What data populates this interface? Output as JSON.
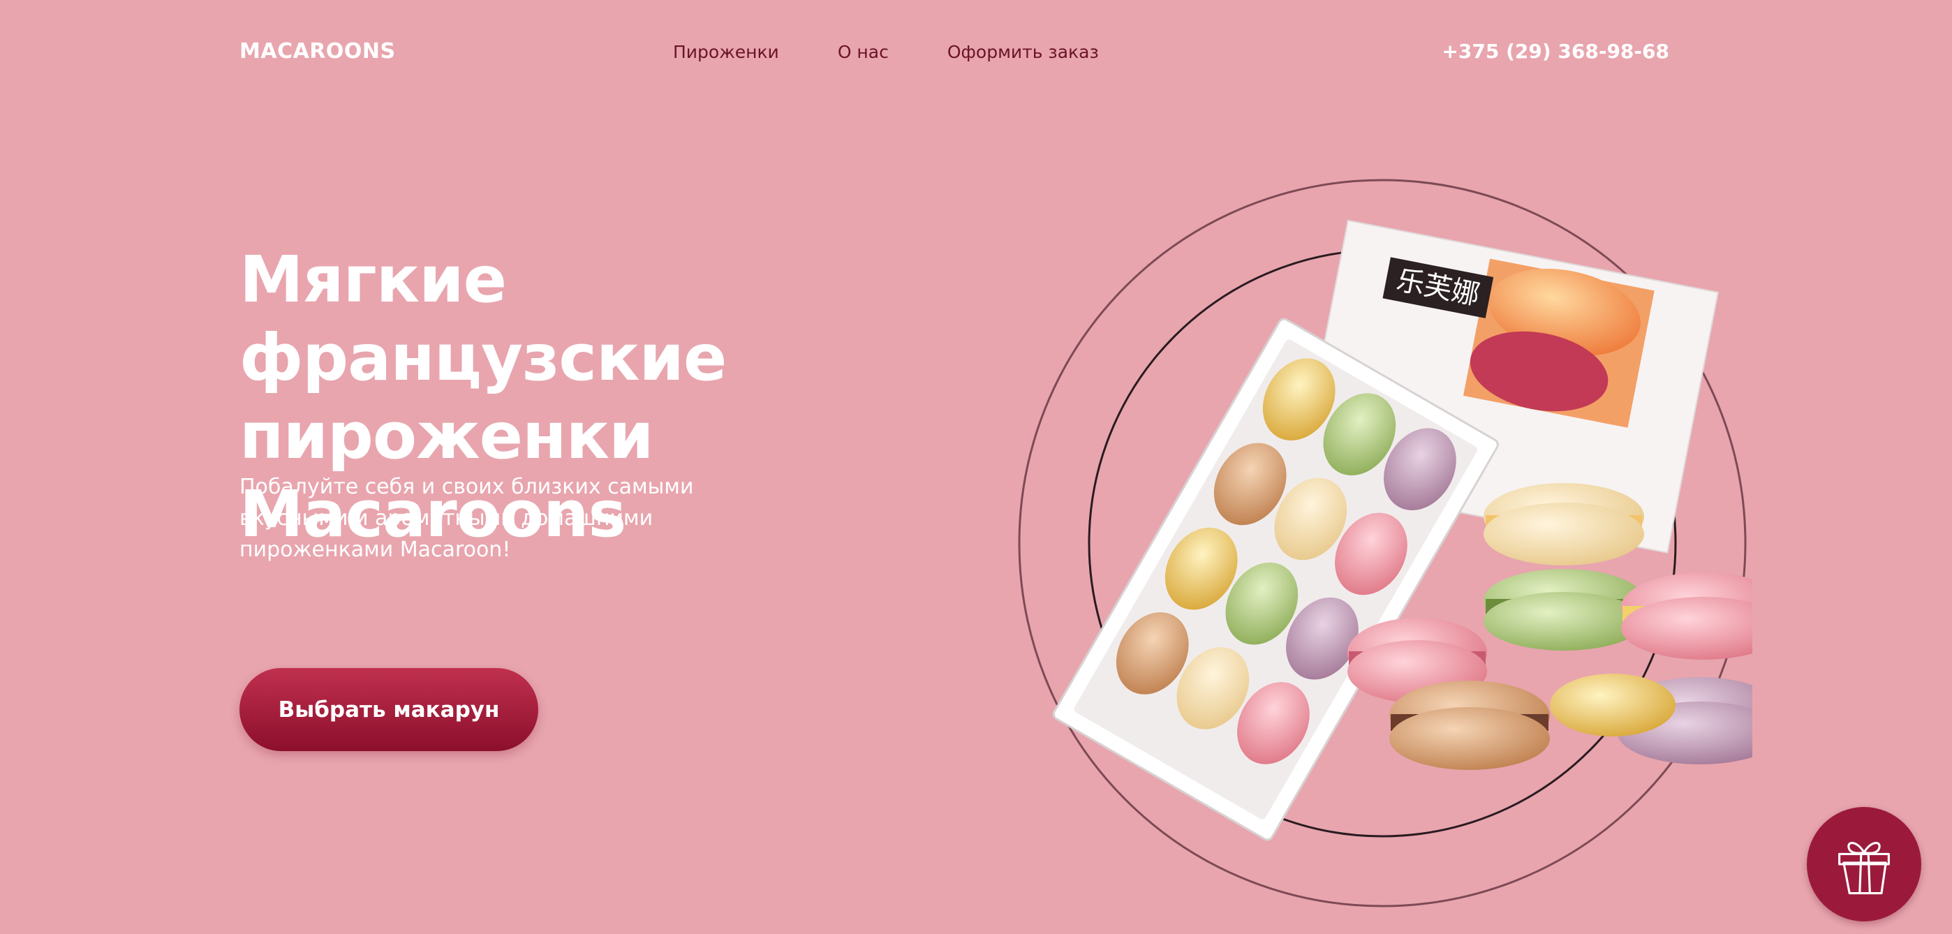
{
  "header": {
    "logo": "MACAROONS",
    "nav": [
      "Пироженки",
      "О нас",
      "Оформить заказ"
    ],
    "phone": "+375 (29) 368-98-68"
  },
  "hero": {
    "title_line1": "Мягкие французские",
    "title_line2": "пироженки Macaroons",
    "subtitle_line1": "Побалуйте себя и своих близких самыми",
    "subtitle_line2": "вкусными и ароматными домашними",
    "subtitle_line3": "пироженками Macaroon!",
    "cta_label": "Выбрать макарун"
  },
  "illustration": {
    "box_label": "乐芙娜",
    "icon": "macarons-box-image"
  },
  "floating": {
    "icon": "gift-icon"
  },
  "colors": {
    "background": "#e8a5ae",
    "accent": "#9b1a3b",
    "nav_text": "#6b1427",
    "text_light": "#ffffff"
  }
}
